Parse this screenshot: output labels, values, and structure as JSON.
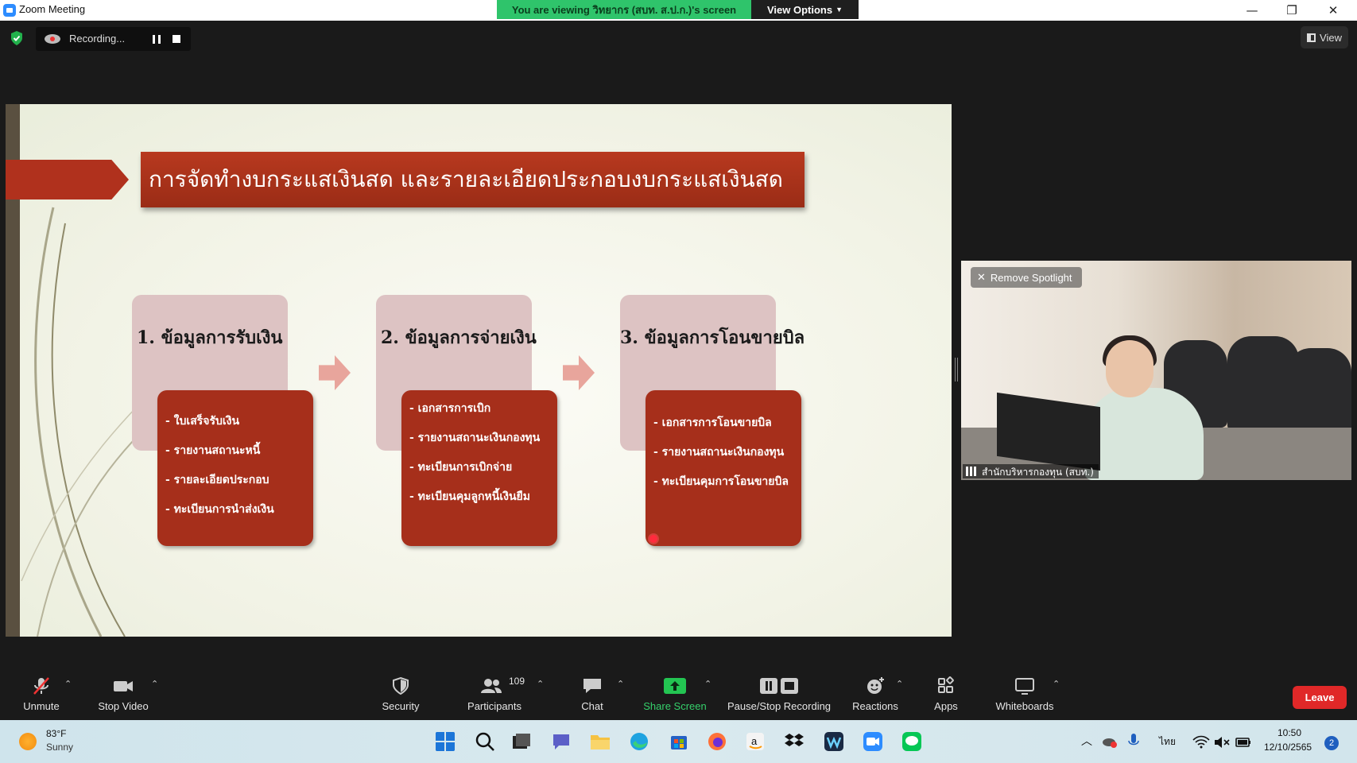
{
  "window": {
    "title": "Zoom Meeting",
    "viewing_banner": "You are viewing วิทยากร (สบท. ส.ป.ก.)'s screen",
    "view_options": "View Options",
    "minimize": "—",
    "restore": "❐",
    "close": "✕"
  },
  "recording": {
    "label": "Recording..."
  },
  "view_button": {
    "label": "View"
  },
  "slide": {
    "title": "การจัดทำงบกระแสเงินสด และรายละเอียดประกอบงบกระแสเงินสด",
    "cards": [
      {
        "heading": "1. ข้อมูลการรับเงิน",
        "items": [
          "- ใบเสร็จรับเงิน",
          "- รายงานสถานะหนี้",
          "- รายละเอียดประกอบ",
          "- ทะเบียนการนำส่งเงิน"
        ]
      },
      {
        "heading": "2. ข้อมูลการจ่ายเงิน",
        "items": [
          "- เอกสารการเบิก",
          "- รายงานสถานะเงินกองทุน",
          "- ทะเบียนการเบิกจ่าย",
          "- ทะเบียนคุมลูกหนี้เงินยืม"
        ]
      },
      {
        "heading": "3. ข้อมูลการโอนขายบิล",
        "items": [
          "- เอกสารการโอนขายบิล",
          "- รายงานสถานะเงินกองทุน",
          "- ทะเบียนคุมการโอนขายบิล"
        ]
      }
    ]
  },
  "video": {
    "remove_spotlight": "Remove Spotlight",
    "participant_name": "สำนักบริหารกองทุน (สบท.)"
  },
  "toolbar": {
    "unmute": "Unmute",
    "stop_video": "Stop Video",
    "security": "Security",
    "participants": "Participants",
    "participants_count": "109",
    "chat": "Chat",
    "share_screen": "Share Screen",
    "pause_stop_recording": "Pause/Stop Recording",
    "reactions": "Reactions",
    "apps": "Apps",
    "whiteboards": "Whiteboards",
    "leave": "Leave",
    "caret": "⌃"
  },
  "taskbar": {
    "weather_temp": "83°F",
    "weather_cond": "Sunny",
    "language": "ไทย",
    "time": "10:50",
    "date": "12/10/2565",
    "notifications": "2"
  },
  "colors": {
    "slide_red": "#a62f1b",
    "card_pink": "#ddc3c3",
    "banner_green": "#2fc46b",
    "leave_red": "#e02828",
    "share_green": "#35d06b"
  }
}
